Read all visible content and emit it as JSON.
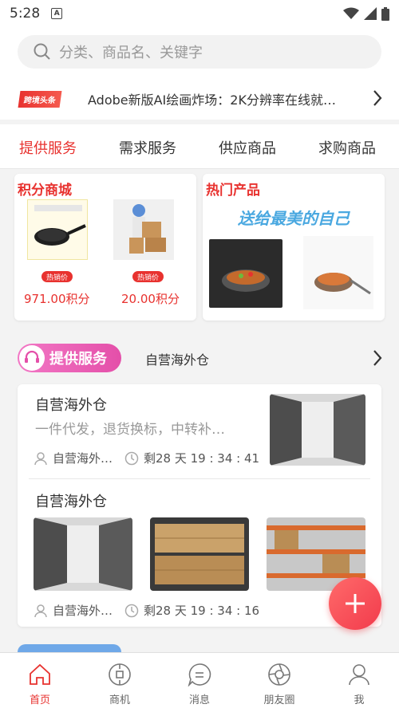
{
  "status": {
    "time": "5:28"
  },
  "search": {
    "placeholder": "分类、商品名、关键字"
  },
  "ticker": {
    "badge": "跨境头条",
    "text": "Adobe新版AI绘画炸场：2K分辨率在线就…"
  },
  "tabs": [
    {
      "label": "提供服务",
      "active": true
    },
    {
      "label": "需求服务",
      "active": false
    },
    {
      "label": "供应商品",
      "active": false
    },
    {
      "label": "求购商品",
      "active": false
    }
  ],
  "points_mall": {
    "title": "积分商城",
    "products": [
      {
        "image": "frying-pan",
        "tag": "热销价",
        "price": "971.00积分"
      },
      {
        "image": "delivery-worker-boxes",
        "tag": "热销价",
        "price": "20.00积分"
      }
    ]
  },
  "hot_products": {
    "title": "热门产品",
    "banner_text": "送给最美的自己"
  },
  "service_section": {
    "pill_label": "提供服务",
    "subtitle": "自营海外仓",
    "items": [
      {
        "title": "自营海外仓",
        "desc": "一件代发，退货换标，中转补…",
        "user": "自营海外…",
        "countdown": "剩28 天 19 : 34 : 41"
      },
      {
        "title": "自营海外仓",
        "user": "自营海外…",
        "countdown": "剩28 天 19 : 34 : 16"
      }
    ]
  },
  "bottom_nav": [
    {
      "label": "首页",
      "icon": "home-icon",
      "active": true
    },
    {
      "label": "商机",
      "icon": "opportunity-icon",
      "active": false
    },
    {
      "label": "消息",
      "icon": "message-icon",
      "active": false
    },
    {
      "label": "朋友圈",
      "icon": "moments-icon",
      "active": false
    },
    {
      "label": "我",
      "icon": "profile-icon",
      "active": false
    }
  ],
  "colors": {
    "accent": "#e8322f",
    "pill": "#e44fa9",
    "fab": "#f23b4c"
  }
}
